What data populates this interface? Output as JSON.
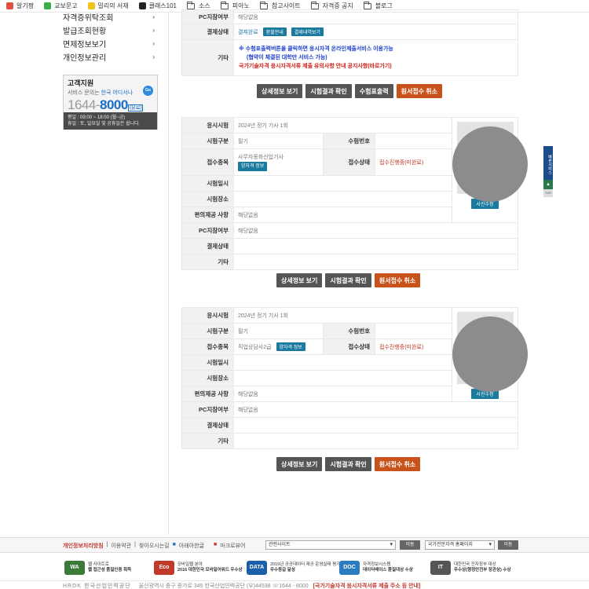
{
  "bookmarks": [
    {
      "label": "알기짱",
      "color": "#e0503a"
    },
    {
      "label": "교보문고",
      "color": "#3cae45"
    },
    {
      "label": "밀리의 서재",
      "color": "#f2c418"
    },
    {
      "label": "클래스101",
      "color": "#222222"
    },
    {
      "label": "소스"
    },
    {
      "label": "피아노"
    },
    {
      "label": "참고사이트"
    },
    {
      "label": "자격증 공지"
    },
    {
      "label": "블로그"
    }
  ],
  "sidebar": {
    "menu": [
      "자격증위탁조회",
      "발급조회현황",
      "면제정보보기",
      "개인정보관리"
    ],
    "support": {
      "title": "고객지원",
      "sub_prefix": "서비스 문의는",
      "sub_highlight": "한국 어디서나",
      "phone_prefix": "1644-",
      "phone_main": "8000",
      "phone_tag": "(유료)",
      "go": "Go",
      "hours": "평일 : 09:00 ~ 18:00 (월~금)",
      "holiday": "휴일 : 토, 일요일 및 공휴일은 쉽니다."
    }
  },
  "section_top": {
    "pc_label": "PC지참여부",
    "pc_value": "해당없음",
    "status_label": "결제상태",
    "status_value": "결제완료",
    "status_btn1": "환불안내",
    "status_btn2": "결제내역보기",
    "etc_label": "기타",
    "notice1": "※ 수험표출력버튼을 클릭하면 응시자격 온라인제출서비스 이용가능",
    "notice2": "(협약이 체결된 대학만 서비스 가능)",
    "notice3": "국가기술자격 응시자격서류 제출 유의사항 안내 공지사항(바로가기)",
    "buttons": [
      "상세정보 보기",
      "시험결과 확인",
      "수험표출력",
      "원서접수 취소"
    ]
  },
  "labels": {
    "exam": "응시시험",
    "category": "시험구분",
    "exam_no": "수험번호",
    "field": "접수종목",
    "status": "접수상태",
    "date": "시험일시",
    "place": "시험장소",
    "convenience": "편의제공 사항",
    "pc": "PC지참여부",
    "payment": "결제상태",
    "etc": "기타",
    "photo_btn": "사진수정",
    "field_btn": "양자격 정보"
  },
  "sections": [
    {
      "exam": "2024년 정기 기사 1회",
      "category": "필기",
      "exam_no": "",
      "field": "사무자동화산업기사",
      "status": "접수진행중(미완료)",
      "date": "",
      "place": "",
      "convenience": "해당없음",
      "pc": "해당없음",
      "payment": "",
      "etc": "",
      "buttons": [
        "상세정보 보기",
        "시험결과 확인",
        "원서접수 취소"
      ]
    },
    {
      "exam": "2024년 정기 기사 1회",
      "category": "필기",
      "exam_no": "",
      "field": "직업상담사2급",
      "status": "접수진행중(미완료)",
      "date": "",
      "place": "",
      "convenience": "해당없음",
      "pc": "해당없음",
      "payment": "",
      "etc": "",
      "buttons": [
        "상세정보 보기",
        "시험결과 확인",
        "원서접수 취소"
      ]
    }
  ],
  "float_widget": {
    "label": "빠른서비스",
    "up": "▲",
    "top": "TOP"
  },
  "footer": {
    "privacy": "개인정보처리방침",
    "links": [
      "이용약관",
      "찾아오시는길"
    ],
    "link_icon1": "아래아한글",
    "link_icon2": "마크로뷰어",
    "select1": "관련사이트",
    "select2": "국가전문자격 홈페이지",
    "go": "이동",
    "awards": [
      {
        "logo": "WA",
        "line1": "웹 사이트로",
        "line2": "웹 접근성 품질인증 획득",
        "color": "#3d7a3a"
      },
      {
        "logo": "Eco",
        "line1": "모바일웹 분야",
        "line2": "2016 대한민국 모바일어워드 우수상",
        "color": "#c0392b"
      },
      {
        "logo": "DATA",
        "line1": "2019년 공공데이터 제공 운영실태 평가",
        "line2": "우수등급 달성",
        "color": "#1a5fa8"
      },
      {
        "logo": "DOC",
        "line1": "자격정보시스템",
        "line2": "데이터베이스 품질대상 수상",
        "color": "#2a7bbf"
      },
      {
        "logo": "IT",
        "line1": "대한민국 전자정부 대상",
        "line2": "우수상(행정안전부 장관상) 수상",
        "color": "#555555"
      }
    ],
    "org": "HRDK 한국산업인력공단",
    "address": "울산광역시 중구 종가로 345 한국산업인력공단 (우)44538 ☏1644 - 8000",
    "notice": "[국가기술자격 응시자격서류 제출 주소 등 안내]"
  }
}
